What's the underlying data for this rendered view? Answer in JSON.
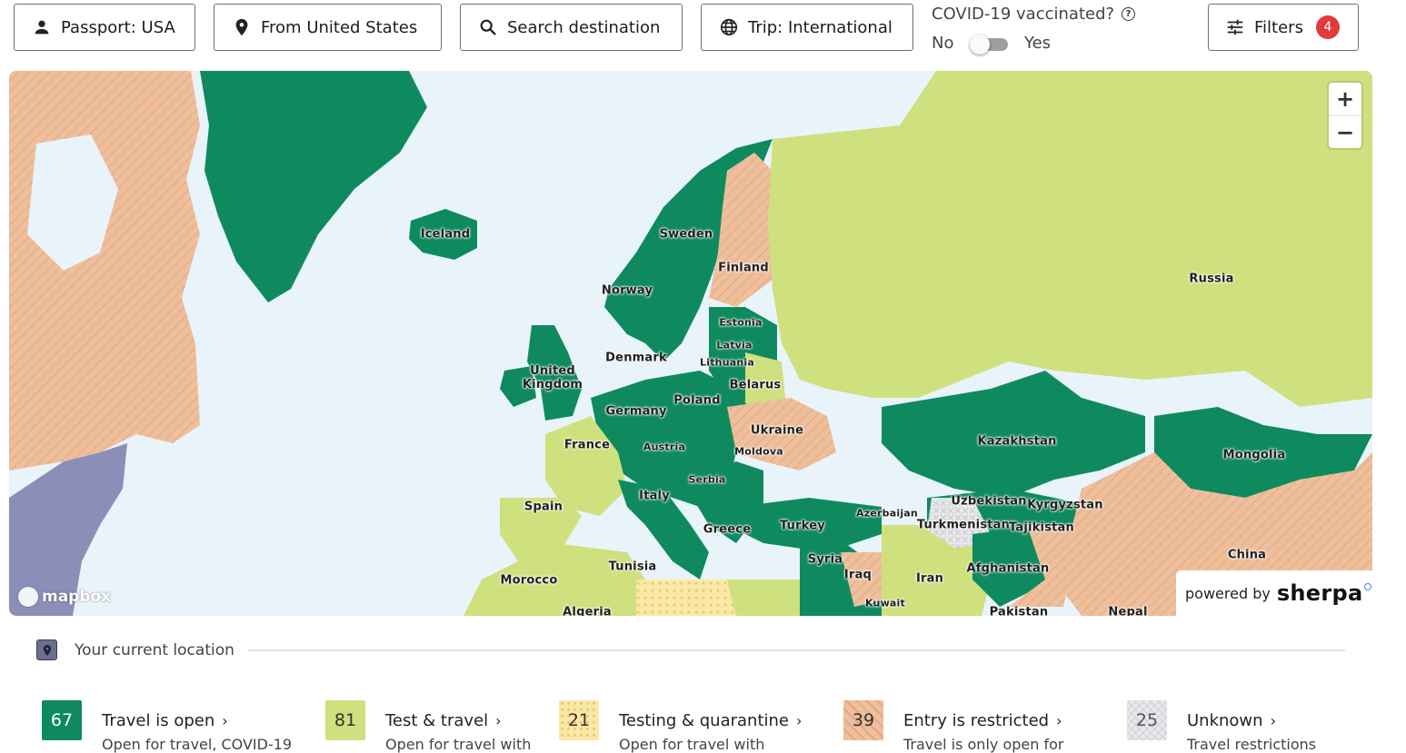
{
  "toolbar": {
    "passport": "Passport: USA",
    "from": "From United States",
    "search_placeholder": "Search destination",
    "trip": "Trip: International",
    "vaccinated_question": "COVID-19 vaccinated?",
    "toggle_no": "No",
    "toggle_yes": "Yes",
    "filters": "Filters",
    "filters_count": "4"
  },
  "map": {
    "attribution": "mapbox",
    "powered_by": "powered by",
    "brand": "sherpa",
    "zoom_in": "+",
    "zoom_out": "−",
    "labels": [
      "Iceland",
      "Sweden",
      "Finland",
      "Norway",
      "Estonia",
      "Latvia",
      "Denmark",
      "Lithuania",
      "United Kingdom",
      "Belarus",
      "Poland",
      "Germany",
      "Ukraine",
      "France",
      "Austria",
      "Moldova",
      "Serbia",
      "Italy",
      "Spain",
      "Greece",
      "Turkey",
      "Azerbaijan",
      "Syria",
      "Iraq",
      "Tunisia",
      "Morocco",
      "Algeria",
      "Iran",
      "Kuwait",
      "Russia",
      "Kazakhstan",
      "Uzbekistan",
      "Kyrgyzstan",
      "Turkmenistan",
      "Tajikistan",
      "Afghanistan",
      "Mongolia",
      "China",
      "Pakistan",
      "Nepal"
    ]
  },
  "colors": {
    "open": "#0f8a5f",
    "test": "#cfe07e",
    "quarantine": "#fbe7a6",
    "restricted": "#efbf9b",
    "unknown": "#e6e8ec",
    "water": "#e8f4fa",
    "current_location": "#8b8fb8"
  },
  "current_location": {
    "label": "Your current location"
  },
  "legend": [
    {
      "count": "67",
      "title": "Travel is open",
      "desc": "Open for travel, COVID-19"
    },
    {
      "count": "81",
      "title": "Test & travel",
      "desc": "Open for travel with"
    },
    {
      "count": "21",
      "title": "Testing & quarantine",
      "desc": "Open for travel with"
    },
    {
      "count": "39",
      "title": "Entry is restricted",
      "desc": "Travel is only open for"
    },
    {
      "count": "25",
      "title": "Unknown",
      "desc": "Travel restrictions"
    }
  ]
}
